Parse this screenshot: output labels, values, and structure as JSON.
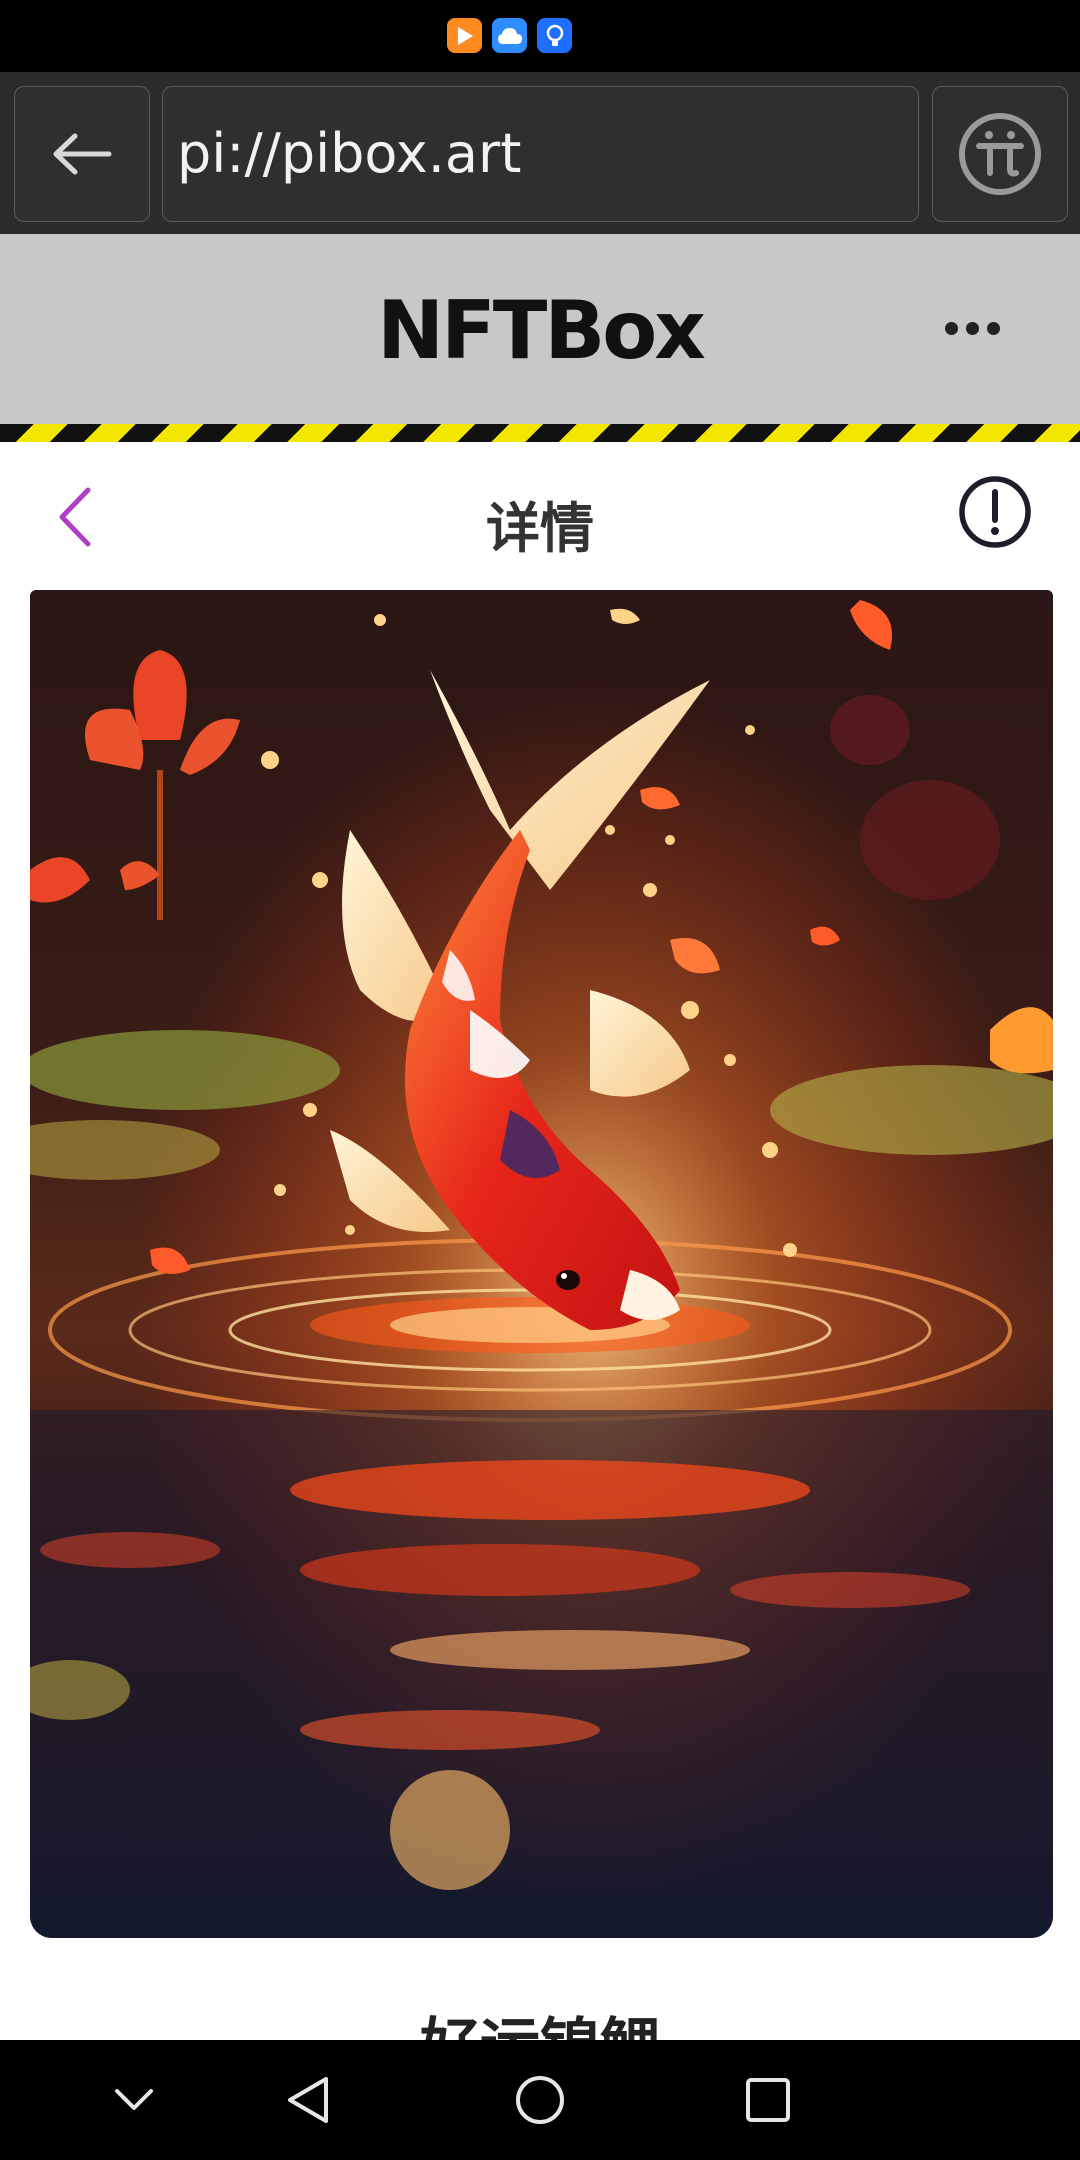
{
  "browser": {
    "url": "pi://pibox.art"
  },
  "app": {
    "title": "NFTBox"
  },
  "detail": {
    "title": "详情",
    "nft_name": "好运锦鲤"
  },
  "icons": {
    "status": [
      "video-app-icon",
      "cloud-app-icon",
      "tips-app-icon"
    ],
    "browser_back": "arrow-left-icon",
    "pi_logo": "pi-logo-icon",
    "more": "more-dots-icon",
    "nav_back": "chevron-left-icon",
    "info": "exclamation-circle-icon",
    "system_nav": [
      "chevron-down-icon",
      "triangle-back-icon",
      "circle-home-icon",
      "square-recents-icon"
    ]
  },
  "colors": {
    "accent_purple": "#b13fc5",
    "hazard_yellow": "#f3e600",
    "header_gray": "#c8c8c8"
  }
}
